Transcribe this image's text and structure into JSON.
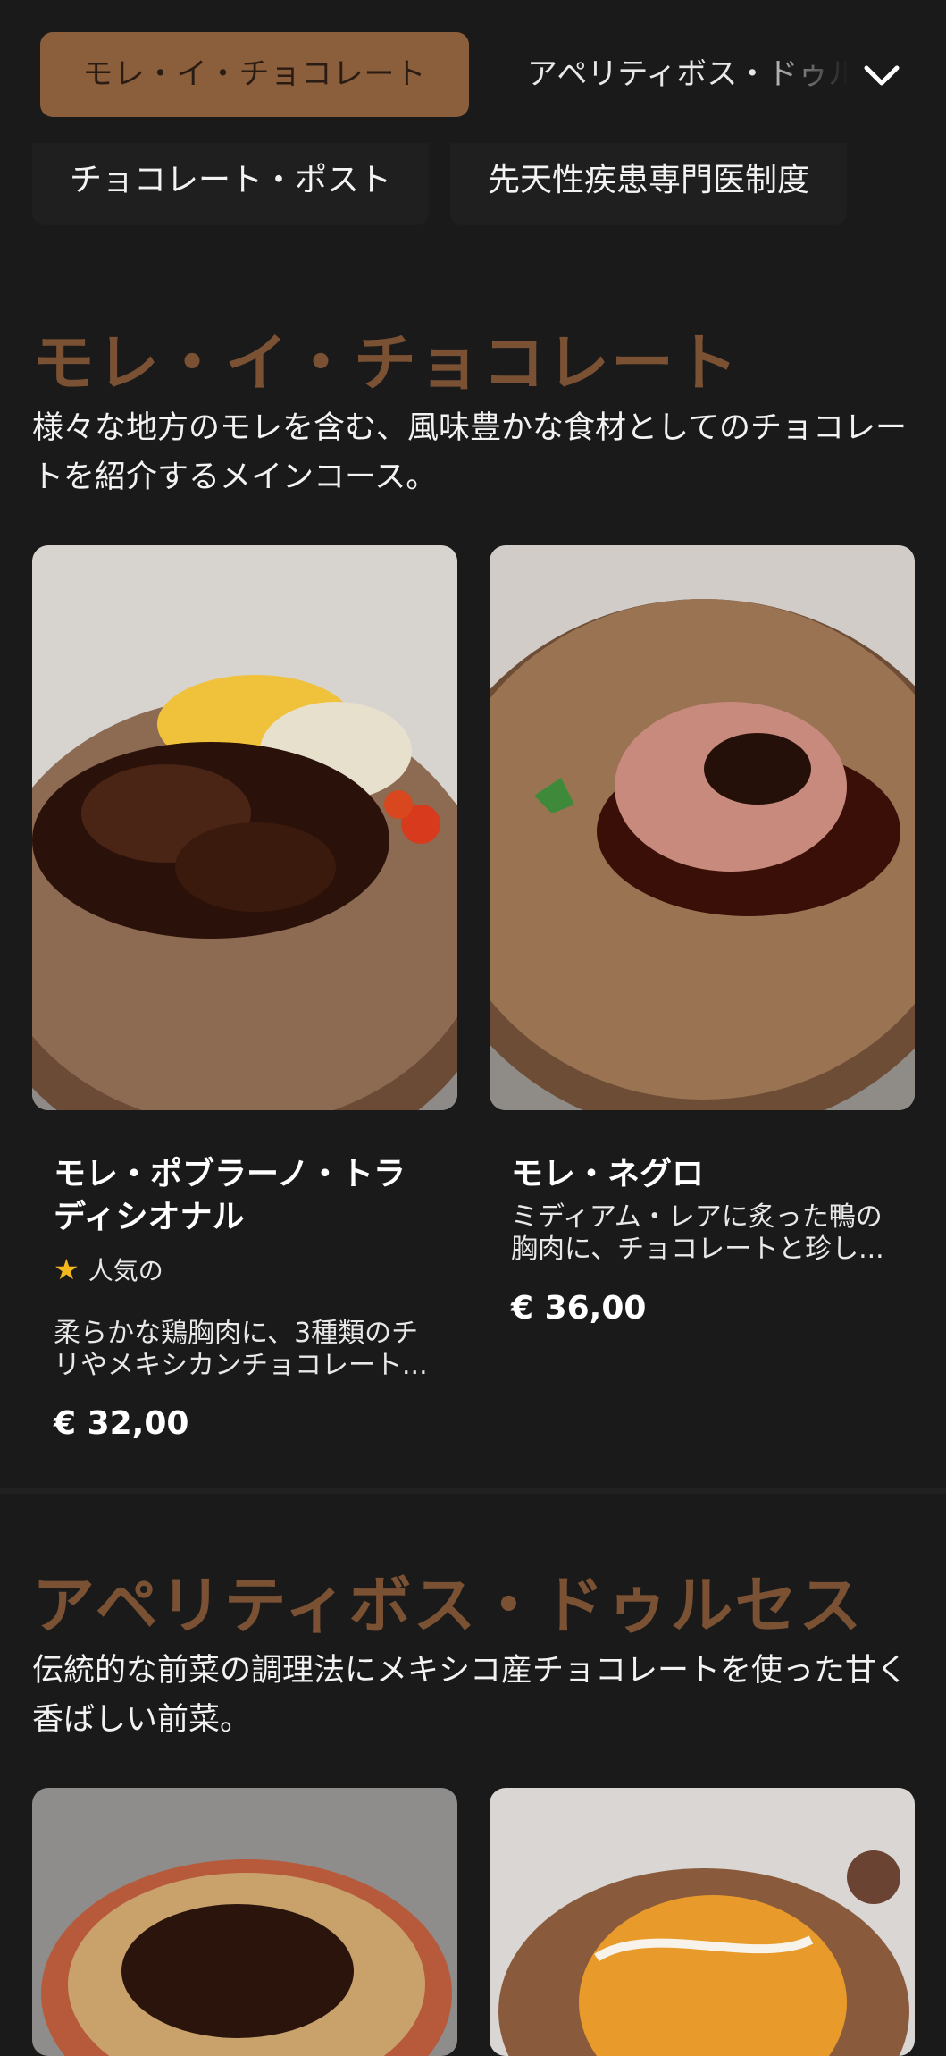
{
  "nav": {
    "active_tab": "モレ・イ・チョコレート",
    "next_tab": "アペリティボス・ドゥルセス",
    "chips": [
      "チョコレート・ポスト",
      "先天性疾患専門医制度"
    ]
  },
  "sections": [
    {
      "title": "モレ・イ・チョコレート",
      "description": "様々な地方のモレを含む、風味豊かな食材としてのチョコレートを紹介するメインコース。",
      "items": [
        {
          "name": "モレ・ポブラーノ・トラディシオナル",
          "badge": "人気の",
          "description": "柔らかな鶏胸肉に、3種類のチリやメキシカンチョコレート...",
          "price": "€ 32,00"
        },
        {
          "name": "モレ・ネグロ",
          "description": "ミディアム・レアに炙った鴨の胸肉に、チョコレートと珍し...",
          "price": "€ 36,00"
        }
      ]
    },
    {
      "title": "アペリティボス・ドゥルセス",
      "description": "伝統的な前菜の調理法にメキシコ産チョコレートを使った甘く香ばしい前菜。"
    }
  ],
  "icons": {
    "dropdown": "chevron-down-icon",
    "popular": "star-icon"
  },
  "colors": {
    "background": "#1a1a1a",
    "accent": "#8b5e3c",
    "section_title": "#7b5134",
    "star": "#f3b81e"
  }
}
